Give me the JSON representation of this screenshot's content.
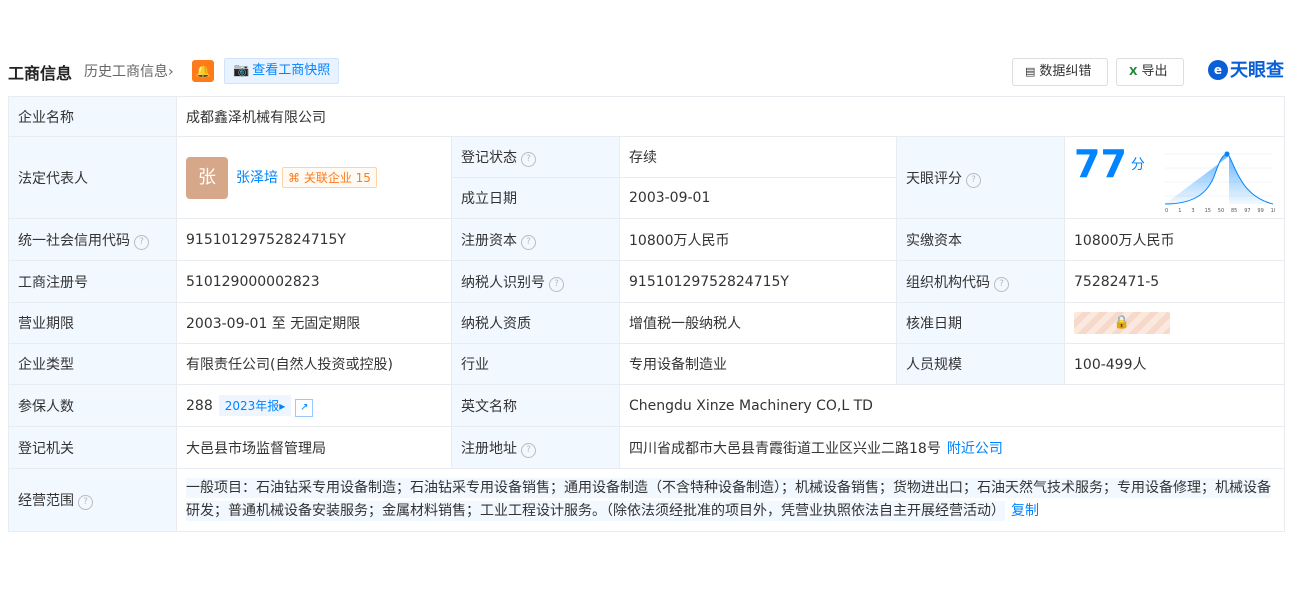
{
  "header": {
    "title": "工商信息",
    "history": "历史工商信息",
    "history_arrow": "›",
    "snapshot": "查看工商快照",
    "correction": "数据纠错",
    "export": "导出",
    "brand": "天眼查"
  },
  "rows": {
    "company_name": {
      "label": "企业名称",
      "value": "成都鑫泽机械有限公司"
    },
    "legal_rep": {
      "label": "法定代表人",
      "avatar": "张",
      "name": "张泽培",
      "assoc_label": "关联企业",
      "assoc_count": "15"
    },
    "reg_status": {
      "label": "登记状态",
      "value": "存续"
    },
    "found_date": {
      "label": "成立日期",
      "value": "2003-09-01"
    },
    "score": {
      "label": "天眼评分",
      "value": "77",
      "unit": "分",
      "axis": [
        "0",
        "1",
        "3",
        "15",
        "50",
        "85",
        "97",
        "99",
        "100"
      ]
    },
    "credit_code": {
      "label": "统一社会信用代码",
      "value": "91510129752824715Y"
    },
    "reg_capital": {
      "label": "注册资本",
      "value": "10800万人民币"
    },
    "paid_capital": {
      "label": "实缴资本",
      "value": "10800万人民币"
    },
    "reg_no": {
      "label": "工商注册号",
      "value": "510129000002823"
    },
    "tax_id": {
      "label": "纳税人识别号",
      "value": "91510129752824715Y"
    },
    "org_code": {
      "label": "组织机构代码",
      "value": "75282471-5"
    },
    "term": {
      "label": "营业期限",
      "value": "2003-09-01 至 无固定期限"
    },
    "tax_qual": {
      "label": "纳税人资质",
      "value": "增值税一般纳税人"
    },
    "approval_date": {
      "label": "核准日期"
    },
    "company_type": {
      "label": "企业类型",
      "value": "有限责任公司(自然人投资或控股)"
    },
    "industry": {
      "label": "行业",
      "value": "专用设备制造业"
    },
    "staff_size": {
      "label": "人员规模",
      "value": "100-499人"
    },
    "insured": {
      "label": "参保人数",
      "value": "288",
      "year_report": "2023年报"
    },
    "english_name": {
      "label": "英文名称",
      "value": "Chengdu Xinze Machinery CO,L TD"
    },
    "authority": {
      "label": "登记机关",
      "value": "大邑县市场监督管理局"
    },
    "address": {
      "label": "注册地址",
      "value": "四川省成都市大邑县青霞街道工业区兴业二路18号",
      "nearby": "附近公司"
    },
    "scope": {
      "label": "经营范围",
      "value": "一般项目：石油钻采专用设备制造；石油钻采专用设备销售；通用设备制造（不含特种设备制造）；机械设备销售；货物进出口；石油天然气技术服务；专用设备修理；机械设备研发；普通机械设备安装服务；金属材料销售；工业工程设计服务。（除依法须经批准的项目外，凭营业执照依法自主开展经营活动）",
      "copy": "复制"
    }
  },
  "icons": {
    "help": "?",
    "bell": "🔔",
    "camera": "📷",
    "doc": "▤",
    "excel": "X",
    "trend": "↗",
    "lock": "🔒",
    "assoc": "⌘",
    "brand_logo": "e"
  }
}
